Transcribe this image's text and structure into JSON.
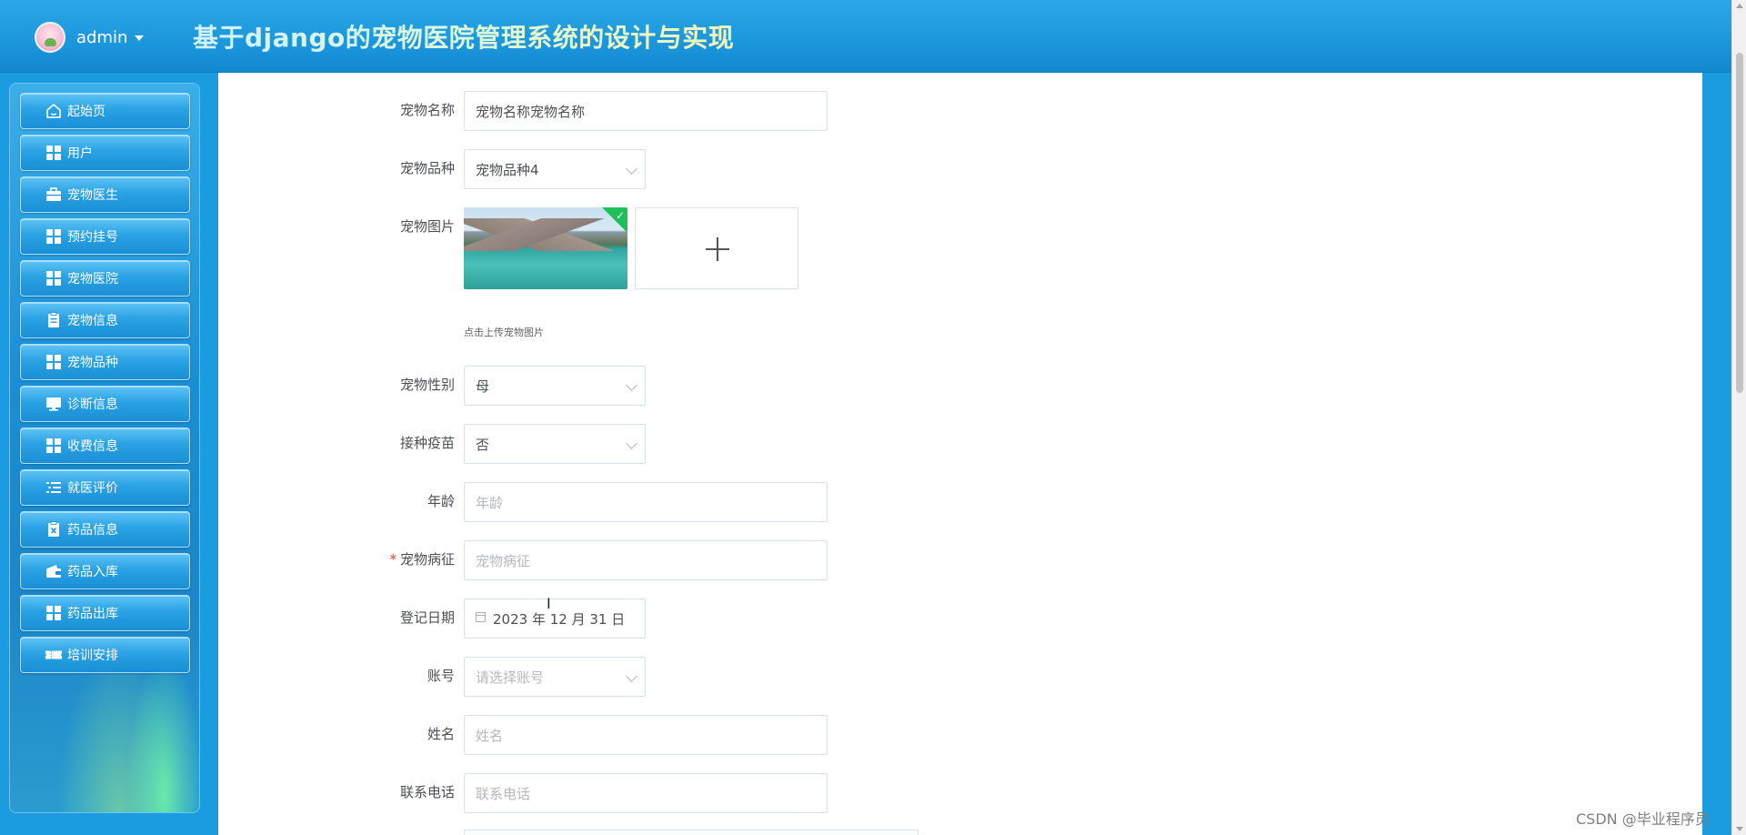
{
  "header": {
    "user_name": "admin",
    "app_title": "基于django的宠物医院管理系统的设计与实现"
  },
  "sidebar": {
    "items": [
      {
        "label": "起始页",
        "icon": "home-icon"
      },
      {
        "label": "用户",
        "icon": "grid-icon"
      },
      {
        "label": "宠物医生",
        "icon": "briefcase-icon"
      },
      {
        "label": "预约挂号",
        "icon": "grid-icon"
      },
      {
        "label": "宠物医院",
        "icon": "grid-icon"
      },
      {
        "label": "宠物信息",
        "icon": "clipboard-icon"
      },
      {
        "label": "宠物品种",
        "icon": "grid-icon"
      },
      {
        "label": "诊断信息",
        "icon": "monitor-icon"
      },
      {
        "label": "收费信息",
        "icon": "grid-icon"
      },
      {
        "label": "就医评价",
        "icon": "list-icon"
      },
      {
        "label": "药品信息",
        "icon": "clipboard-x-icon"
      },
      {
        "label": "药品入库",
        "icon": "wallet-icon"
      },
      {
        "label": "药品出库",
        "icon": "grid-icon"
      },
      {
        "label": "培训安排",
        "icon": "ticket-icon"
      }
    ]
  },
  "form": {
    "pet_name": {
      "label": "宠物名称",
      "value": "宠物名称宠物名称"
    },
    "pet_breed": {
      "label": "宠物品种",
      "value": "宠物品种4"
    },
    "pet_image": {
      "label": "宠物图片",
      "tip": "点击上传宠物图片"
    },
    "pet_gender": {
      "label": "宠物性别",
      "value": "母"
    },
    "vaccinated": {
      "label": "接种疫苗",
      "value": "否"
    },
    "age": {
      "label": "年龄",
      "placeholder": "年龄"
    },
    "symptoms": {
      "label": "宠物病征",
      "placeholder": "宠物病征",
      "required_mark": "*"
    },
    "register_date": {
      "label": "登记日期",
      "value": "2023 年 12 月 31 日"
    },
    "account": {
      "label": "账号",
      "placeholder": "请选择账号"
    },
    "name": {
      "label": "姓名",
      "placeholder": "姓名"
    },
    "phone": {
      "label": "联系电话",
      "placeholder": "联系电话"
    }
  },
  "watermark": "CSDN @毕业程序员",
  "colors": {
    "header_blue": "#1b96dc",
    "title_gradient_start": "#c7f0ff",
    "title_gradient_end": "#f5f3a8",
    "menu_blue": "#2aa2e4",
    "required_red": "#e0452e"
  }
}
